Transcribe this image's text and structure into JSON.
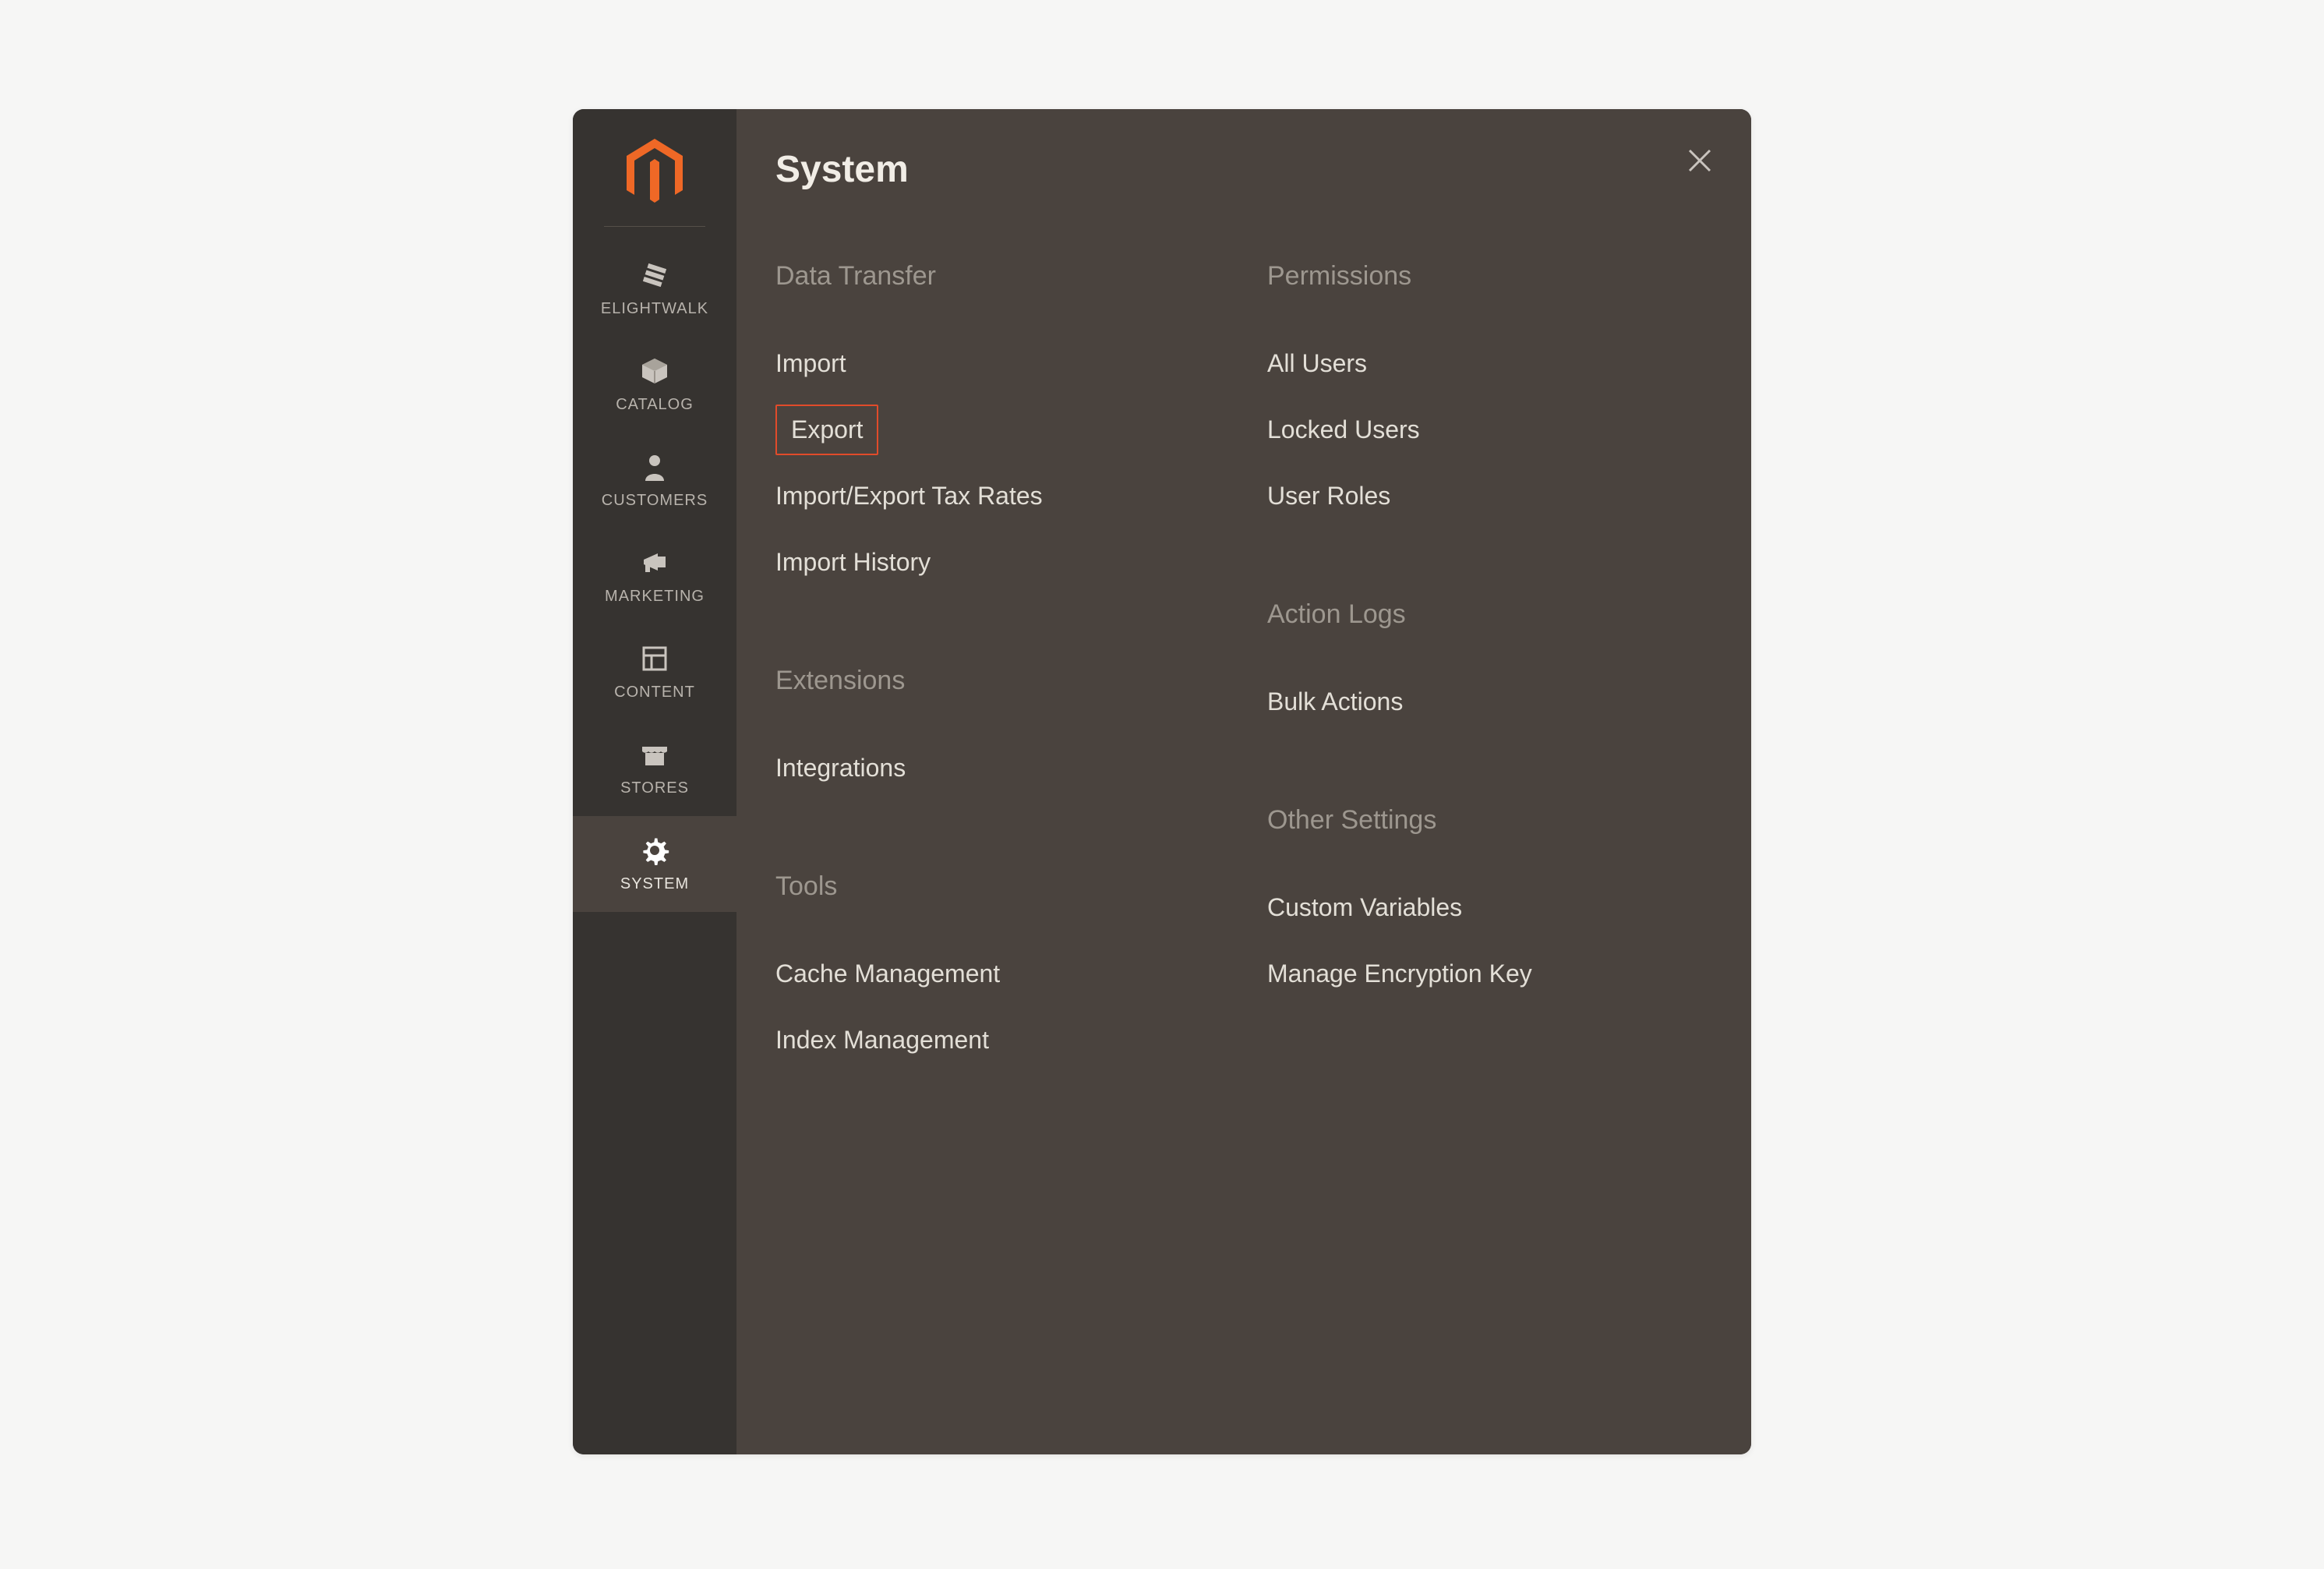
{
  "sidebar": {
    "items": [
      {
        "label": "ELIGHTWALK"
      },
      {
        "label": "CATALOG"
      },
      {
        "label": "CUSTOMERS"
      },
      {
        "label": "MARKETING"
      },
      {
        "label": "CONTENT"
      },
      {
        "label": "STORES"
      },
      {
        "label": "SYSTEM"
      }
    ]
  },
  "panel": {
    "title": "System",
    "columns": [
      {
        "sections": [
          {
            "heading": "Data Transfer",
            "links": [
              {
                "label": "Import",
                "highlight": false
              },
              {
                "label": "Export",
                "highlight": true
              },
              {
                "label": "Import/Export Tax Rates",
                "highlight": false
              },
              {
                "label": "Import History",
                "highlight": false
              }
            ]
          },
          {
            "heading": "Extensions",
            "links": [
              {
                "label": "Integrations",
                "highlight": false
              }
            ]
          },
          {
            "heading": "Tools",
            "links": [
              {
                "label": "Cache Management",
                "highlight": false
              },
              {
                "label": "Index Management",
                "highlight": false
              }
            ]
          }
        ]
      },
      {
        "sections": [
          {
            "heading": "Permissions",
            "links": [
              {
                "label": "All Users",
                "highlight": false
              },
              {
                "label": "Locked Users",
                "highlight": false
              },
              {
                "label": "User Roles",
                "highlight": false
              }
            ]
          },
          {
            "heading": "Action Logs",
            "links": [
              {
                "label": "Bulk Actions",
                "highlight": false
              }
            ]
          },
          {
            "heading": "Other Settings",
            "links": [
              {
                "label": "Custom Variables",
                "highlight": false
              },
              {
                "label": "Manage Encryption Key",
                "highlight": false
              }
            ]
          }
        ]
      }
    ]
  },
  "colors": {
    "accent": "#e14b2a",
    "sidebar_bg": "#363330",
    "panel_bg": "#4a433e"
  }
}
